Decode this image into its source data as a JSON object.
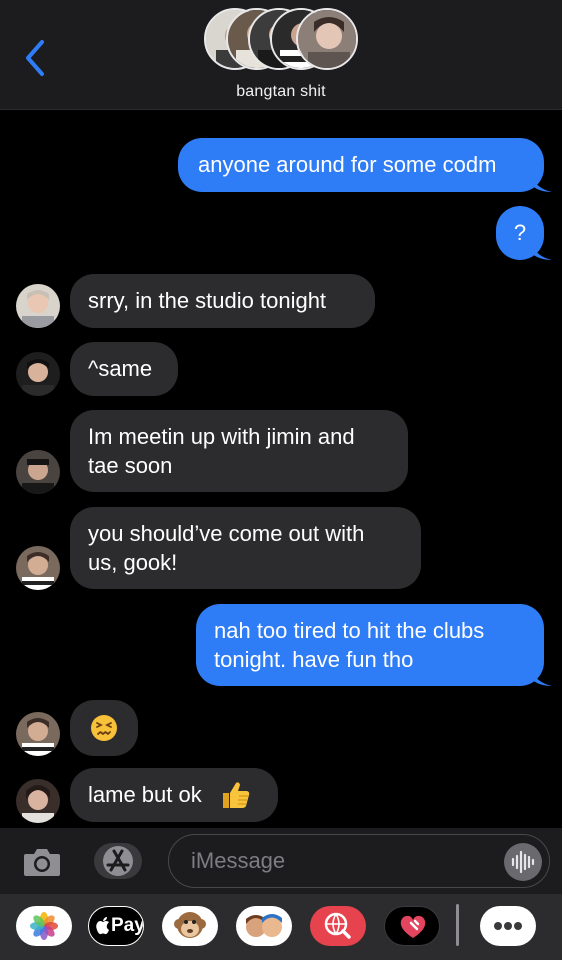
{
  "header": {
    "group_name": "bangtan shit",
    "back_icon": "chevron-left-icon",
    "accent_color": "#2e7cf6"
  },
  "messages": [
    {
      "direction": "sent",
      "lines": [
        "anyone around for some codm"
      ]
    },
    {
      "direction": "sent",
      "lines": [
        "?"
      ]
    },
    {
      "direction": "received",
      "lines": [
        "srry, in the studio tonight"
      ]
    },
    {
      "direction": "received",
      "lines": [
        "^same"
      ]
    },
    {
      "direction": "received",
      "lines": [
        "Im meetin up with jimin and",
        "tae soon"
      ]
    },
    {
      "direction": "received",
      "lines": [
        "you should’ve come out with",
        "us, gook!"
      ]
    },
    {
      "direction": "sent",
      "lines": [
        "nah too tired to hit the clubs",
        "tonight. have fun tho"
      ]
    },
    {
      "direction": "received",
      "lines": [],
      "emoji": "confounded-face"
    },
    {
      "direction": "received",
      "lines": [
        "lame but ok"
      ],
      "emoji": "thumbs-up"
    }
  ],
  "composer": {
    "placeholder": "iMessage",
    "camera_icon": "camera-icon",
    "apps_icon": "app-store-icon",
    "audio_icon": "audio-waveform-icon"
  },
  "app_drawer": {
    "items": [
      "photos",
      "apple-pay",
      "animoji",
      "memoji",
      "web-search",
      "digital-touch",
      "more"
    ],
    "apple_pay_label": "Pay"
  },
  "colors": {
    "sent_bubble": "#2e7cf6",
    "received_bubble": "#2c2c2e",
    "background": "#000000",
    "bar_background": "#1c1c1e"
  }
}
